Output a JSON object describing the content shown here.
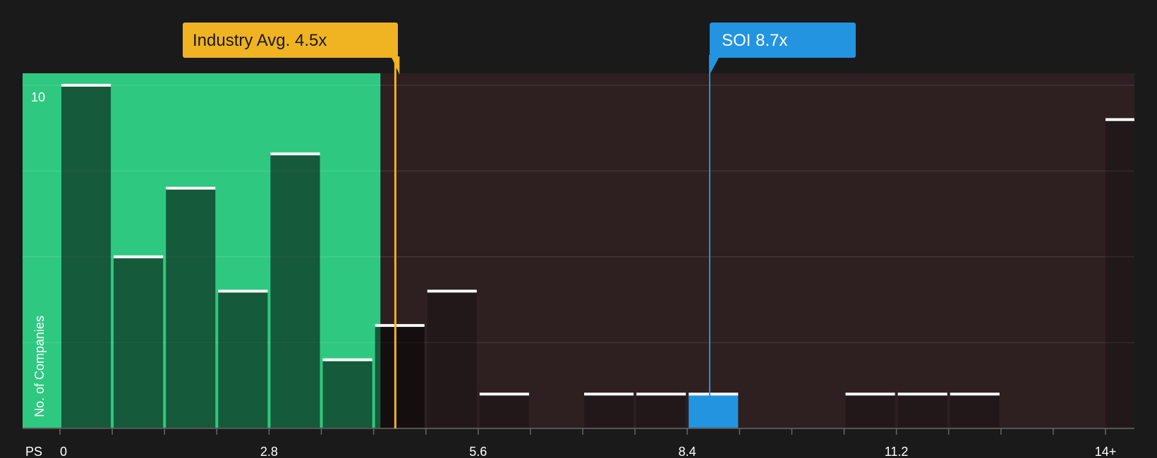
{
  "chart_data": {
    "type": "histogram",
    "xlabel": "PS",
    "ylabel": "No. of Companies",
    "x_tick_labels": [
      {
        "value": 0,
        "label": "0"
      },
      {
        "value": 2.8,
        "label": "2.8"
      },
      {
        "value": 5.6,
        "label": "5.6"
      },
      {
        "value": 8.4,
        "label": "8.4"
      },
      {
        "value": 11.2,
        "label": "11.2"
      },
      {
        "value": 14,
        "label": "14+"
      }
    ],
    "y_tick_labels": [
      {
        "value": 10,
        "label": "10"
      }
    ],
    "xlim": [
      0,
      14.35
    ],
    "ylim": [
      0,
      10
    ],
    "bin_width": 0.7,
    "bins": [
      {
        "start": 0.0,
        "count": 10
      },
      {
        "start": 0.7,
        "count": 5
      },
      {
        "start": 1.4,
        "count": 7
      },
      {
        "start": 2.1,
        "count": 4
      },
      {
        "start": 2.8,
        "count": 8
      },
      {
        "start": 3.5,
        "count": 2
      },
      {
        "start": 4.2,
        "count": 3
      },
      {
        "start": 4.9,
        "count": 4
      },
      {
        "start": 5.6,
        "count": 1
      },
      {
        "start": 6.3,
        "count": 0
      },
      {
        "start": 7.0,
        "count": 1
      },
      {
        "start": 7.7,
        "count": 1
      },
      {
        "start": 8.4,
        "count": 1,
        "highlight": true
      },
      {
        "start": 9.1,
        "count": 0
      },
      {
        "start": 9.8,
        "count": 0
      },
      {
        "start": 10.5,
        "count": 1
      },
      {
        "start": 11.2,
        "count": 1
      },
      {
        "start": 11.9,
        "count": 1
      },
      {
        "start": 12.6,
        "count": 0
      },
      {
        "start": 13.3,
        "count": 0
      },
      {
        "start": 14.0,
        "count": 9,
        "overflow": true
      }
    ],
    "industry_avg": {
      "value": 4.5,
      "label": "Industry Avg. 4.5x",
      "color": "#f0b322"
    },
    "company": {
      "name": "SOI",
      "value": 8.7,
      "label": "SOI 8.7x",
      "color": "#2394e0"
    },
    "fair_zone_color": "#2fc881",
    "overvalued_zone_color": "#2e1f20",
    "grid": true
  }
}
